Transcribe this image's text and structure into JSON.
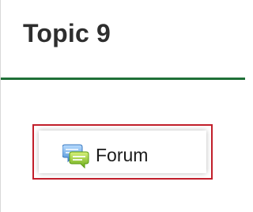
{
  "section": {
    "title": "Topic 9",
    "divider_color": "#1f6f37"
  },
  "activity": {
    "icon": "forum-icon",
    "label": "Forum",
    "highlight_color": "#c21f2b"
  }
}
